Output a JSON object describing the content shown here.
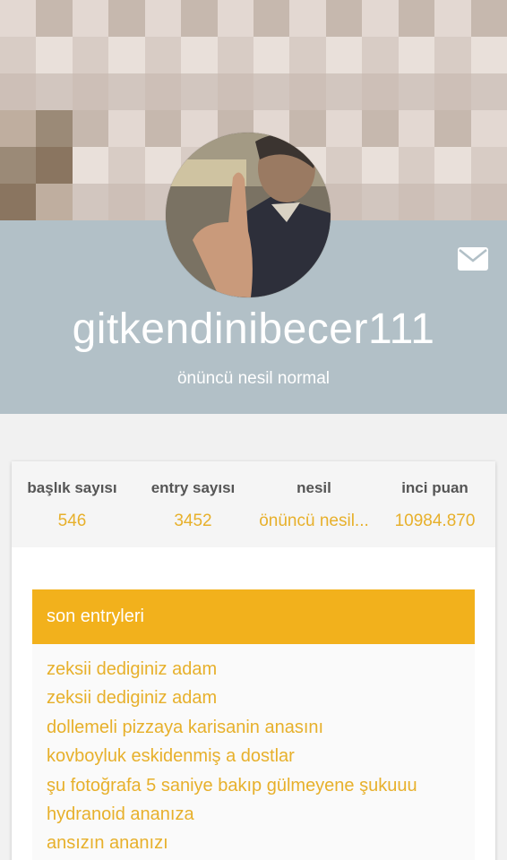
{
  "profile": {
    "username": "gitkendinibecer111",
    "title": "önüncü nesil normal",
    "mail_icon": "mail-icon",
    "avatar_icon": "avatar"
  },
  "stats": [
    {
      "label": "başlık sayısı",
      "value": "546"
    },
    {
      "label": "entry sayısı",
      "value": "3452"
    },
    {
      "label": "nesil",
      "value": "önüncü nesil..."
    },
    {
      "label": "inci puan",
      "value": "10984.870"
    }
  ],
  "entries": {
    "header": "son entryleri",
    "items": [
      "zeksii dediginiz adam",
      "zeksii dediginiz adam",
      "dollemeli pizzaya karisanin anasını",
      "kovboyluk eskidenmiş a dostlar",
      "şu fotoğrafa 5 saniye bakıp gülmeyene şukuuu",
      "hydranoid ananıza",
      "ansızın ananızı"
    ]
  },
  "colors": {
    "band": "#b2c0c7",
    "accent": "#f2b11c",
    "link": "#e7b02b"
  }
}
